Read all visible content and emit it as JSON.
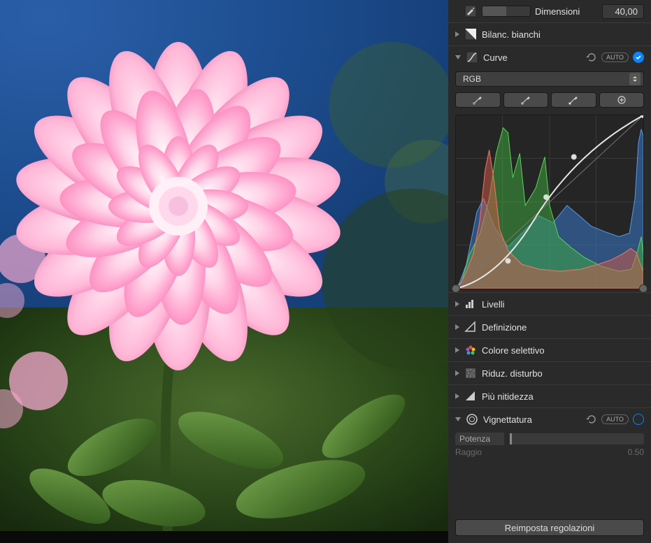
{
  "dimensioni": {
    "label": "Dimensioni",
    "value": "40,00"
  },
  "bilanc": {
    "label": "Bilanc. bianchi"
  },
  "curve": {
    "label": "Curve",
    "auto": "AUTO",
    "channel": "RGB"
  },
  "livelli": {
    "label": "Livelli"
  },
  "definizione": {
    "label": "Definizione"
  },
  "colore_selettivo": {
    "label": "Colore selettivo"
  },
  "riduz_disturbo": {
    "label": "Riduz. disturbo"
  },
  "piu_nitidezza": {
    "label": "Più nitidezza"
  },
  "vignettatura": {
    "label": "Vignettatura",
    "auto": "AUTO",
    "potenza": "Potenza",
    "raggio": "Raggio",
    "raggio_val": "0.50"
  },
  "reset": "Reimposta regolazioni"
}
